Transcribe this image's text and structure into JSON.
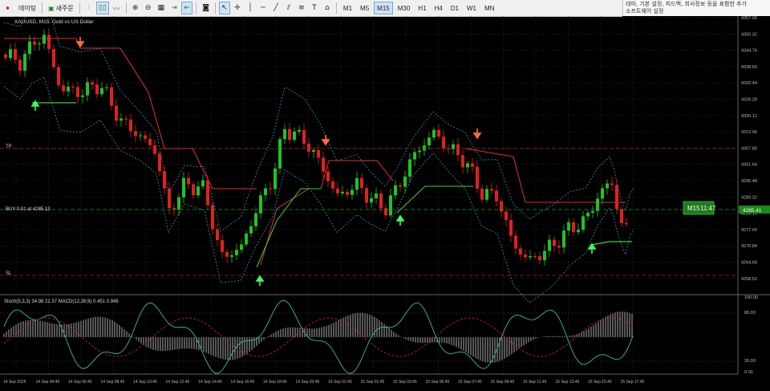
{
  "toolbar": {
    "left_label": "데이팅",
    "new_order_label": "새주문",
    "timeframes": [
      "M1",
      "M5",
      "M15",
      "M30",
      "H1",
      "H4",
      "D1",
      "W1",
      "MN"
    ],
    "active_timeframe": "M15"
  },
  "side_panel": {
    "line1": "테마, 기본 설정, 피드백, 회사정보 등을 표함한 추가",
    "line2": "소프트웨어 설정"
  },
  "chart": {
    "symbol_caption": "XAUUSD, M15: Gold vs US Dollar",
    "tp_label": "TP",
    "sl_label": "SL",
    "buy_label": "BUY 0.01 at 4285.13",
    "price_axis": [
      "4357.00",
      "4350.32",
      "4344.76",
      "4338.60",
      "4332.44",
      "4326.28",
      "4320.12",
      "4313.96",
      "4307.80",
      "4301.64",
      "4295.48",
      "4289.32",
      "4283.16",
      "4277.00",
      "4270.84",
      "4264.68",
      "4258.52"
    ],
    "current_price": "4285.41",
    "timer_tf": "M15",
    "timer_value": "11:47",
    "time_axis": [
      "14 Sep 2025",
      "14 Sep 04:45",
      "14 Sep 06:45",
      "14 Sep 08:45",
      "14 Sep 10:45",
      "14 Sep 12:45",
      "14 Sep 14:45",
      "14 Sep 16:45",
      "14 Sep 18:45",
      "14 Sep 20:45",
      "14 Sep 22:45",
      "15 Sep 01:45",
      "15 Sep 03:45",
      "15 Sep 05:45",
      "15 Sep 07:45",
      "15 Sep 09:45",
      "15 Sep 11:45",
      "15 Sep 13:45",
      "15 Sep 15:45",
      "15 Sep 17:45"
    ],
    "indicator_caption": "Stoch(5,3,3) 34.98 22.37  MACD(12,26,9) 0.451 0.945",
    "indicator_axis": [
      "100.00",
      "80.00",
      "20.00",
      "0.00"
    ],
    "colors": {
      "bull": "#21c321",
      "bear": "#e02020",
      "band": "#3e8fb5",
      "supertrend_down": "#e0303a",
      "supertrend_up": "#3ad43a",
      "stoch_main": "#35b8b0",
      "stoch_signal": "#c02020"
    }
  }
}
